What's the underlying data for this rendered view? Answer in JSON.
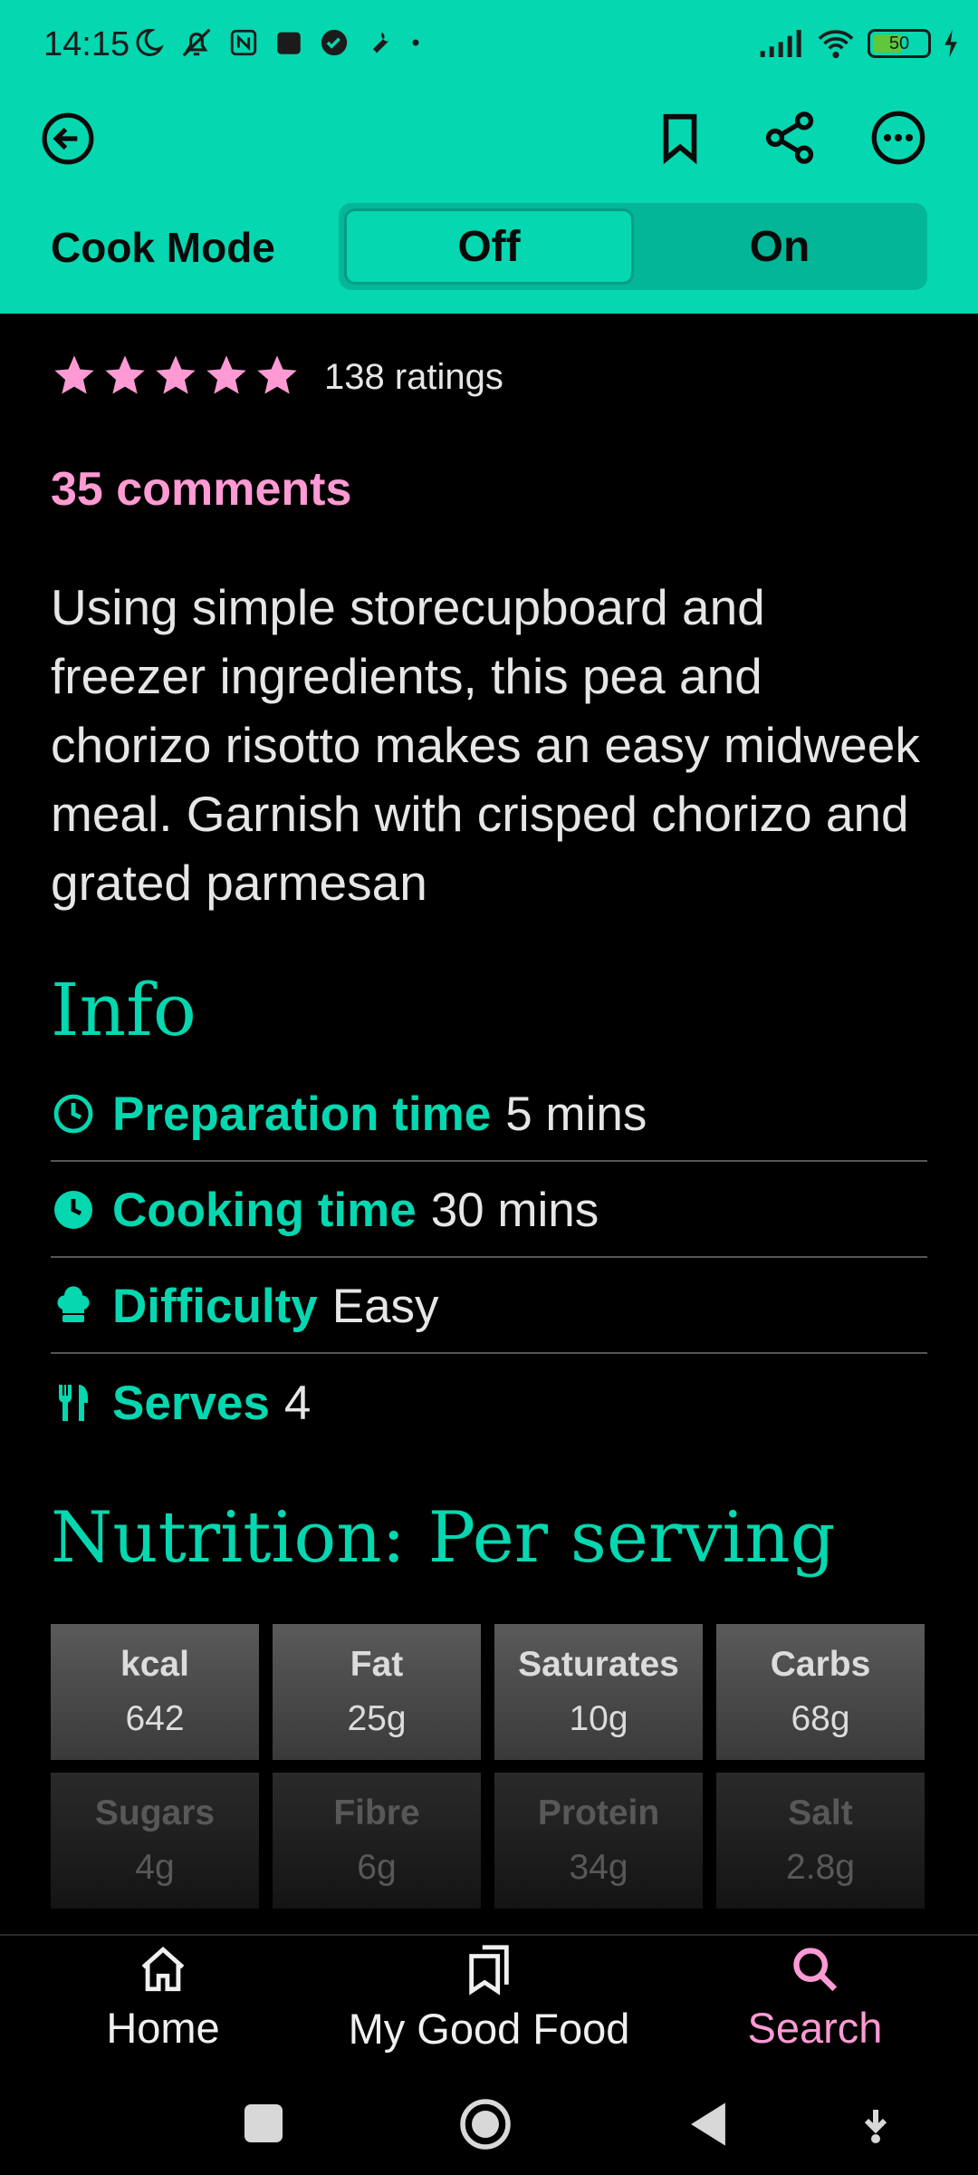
{
  "status": {
    "time": "14:15",
    "battery": "50"
  },
  "appbar": {
    "back_icon": "back-arrow-circle-icon",
    "bookmark_icon": "bookmark-icon",
    "share_icon": "share-icon",
    "more_icon": "more-horizontal-icon"
  },
  "cook_mode": {
    "label": "Cook Mode",
    "options": [
      "Off",
      "On"
    ],
    "selected": "Off"
  },
  "rating": {
    "stars": 5,
    "text": "138 ratings",
    "comments": "35 comments"
  },
  "description": "Using simple storecupboard and freezer ingredients, this pea and chorizo risotto makes an easy midweek meal. Garnish with crisped chorizo and grated parmesan",
  "info": {
    "heading": "Info",
    "rows": [
      {
        "icon": "clock-outline-icon",
        "label": "Preparation time",
        "value": "5 mins"
      },
      {
        "icon": "clock-filled-icon",
        "label": "Cooking time",
        "value": "30 mins"
      },
      {
        "icon": "chef-hat-icon",
        "label": "Difficulty",
        "value": "Easy"
      },
      {
        "icon": "cutlery-icon",
        "label": "Serves",
        "value": "4"
      }
    ]
  },
  "nutrition": {
    "heading": "Nutrition: Per serving",
    "items": [
      {
        "label": "kcal",
        "value": "642"
      },
      {
        "label": "Fat",
        "value": "25g"
      },
      {
        "label": "Saturates",
        "value": "10g"
      },
      {
        "label": "Carbs",
        "value": "68g"
      },
      {
        "label": "Sugars",
        "value": "4g"
      },
      {
        "label": "Fibre",
        "value": "6g"
      },
      {
        "label": "Protein",
        "value": "34g"
      },
      {
        "label": "Salt",
        "value": "2.8g"
      }
    ]
  },
  "bottom_nav": [
    {
      "label": "Home",
      "icon": "home-icon"
    },
    {
      "label": "My Good Food",
      "icon": "saved-recipes-icon"
    },
    {
      "label": "Search",
      "icon": "search-icon",
      "active": true
    }
  ],
  "colors": {
    "accent": "#05d7b0",
    "pink": "#ff9ad4",
    "background": "#000000"
  }
}
